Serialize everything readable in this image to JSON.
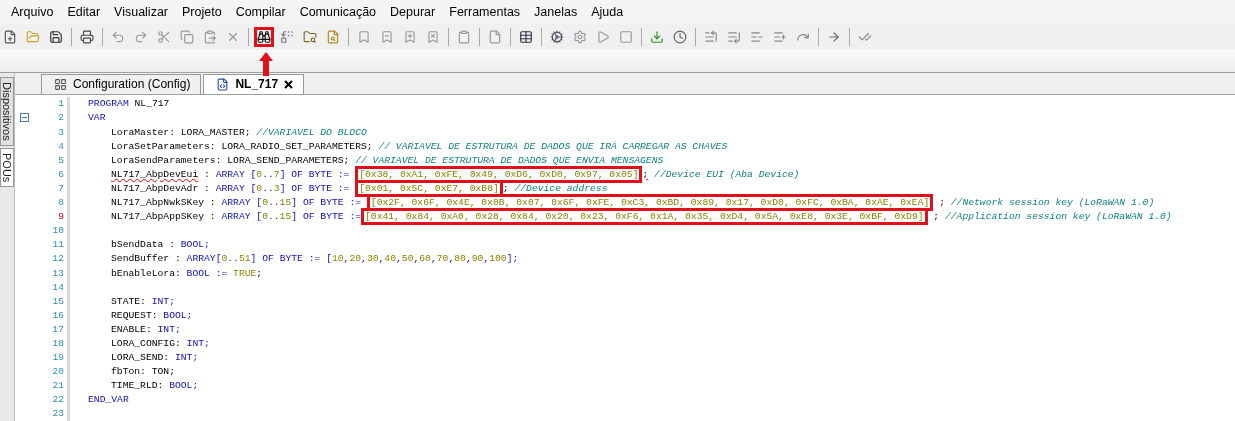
{
  "menu": [
    "Arquivo",
    "Editar",
    "Visualizar",
    "Projeto",
    "Compilar",
    "Comunicação",
    "Depurar",
    "Ferramentas",
    "Janelas",
    "Ajuda"
  ],
  "toolbar": [
    {
      "kind": "button",
      "highlighted": false
    },
    {
      "kind": "button",
      "highlighted": false
    },
    {
      "kind": "button",
      "highlighted": false
    },
    {
      "kind": "separator"
    },
    {
      "kind": "button",
      "highlighted": false
    },
    {
      "kind": "separator"
    },
    {
      "kind": "button",
      "highlighted": false
    },
    {
      "kind": "button",
      "highlighted": false
    },
    {
      "kind": "button",
      "highlighted": false
    },
    {
      "kind": "button",
      "highlighted": false
    },
    {
      "kind": "button",
      "highlighted": false
    },
    {
      "kind": "button",
      "highlighted": false
    },
    {
      "kind": "separator"
    },
    {
      "kind": "button",
      "highlighted": true
    },
    {
      "kind": "button",
      "highlighted": false
    },
    {
      "kind": "button",
      "highlighted": false
    },
    {
      "kind": "button",
      "highlighted": false
    },
    {
      "kind": "separator"
    },
    {
      "kind": "button",
      "highlighted": false
    },
    {
      "kind": "button",
      "highlighted": false
    },
    {
      "kind": "button",
      "highlighted": false
    },
    {
      "kind": "button",
      "highlighted": false
    },
    {
      "kind": "separator"
    },
    {
      "kind": "button",
      "highlighted": false
    },
    {
      "kind": "separator"
    },
    {
      "kind": "button",
      "highlighted": false
    },
    {
      "kind": "separator"
    },
    {
      "kind": "button",
      "highlighted": false
    },
    {
      "kind": "separator"
    },
    {
      "kind": "button",
      "highlighted": false
    },
    {
      "kind": "button",
      "highlighted": false
    },
    {
      "kind": "button",
      "highlighted": false
    },
    {
      "kind": "button",
      "highlighted": false
    },
    {
      "kind": "separator"
    },
    {
      "kind": "button",
      "highlighted": false
    },
    {
      "kind": "button",
      "highlighted": false
    },
    {
      "kind": "separator"
    },
    {
      "kind": "button",
      "highlighted": false
    },
    {
      "kind": "button",
      "highlighted": false
    },
    {
      "kind": "button",
      "highlighted": false
    },
    {
      "kind": "button",
      "highlighted": false
    },
    {
      "kind": "button",
      "highlighted": false
    },
    {
      "kind": "separator"
    },
    {
      "kind": "button",
      "highlighted": false
    },
    {
      "kind": "separator"
    },
    {
      "kind": "button",
      "highlighted": false
    }
  ],
  "side_tabs": [
    {
      "label": "Dispositivos",
      "selected": false
    },
    {
      "label": "POUs",
      "selected": true
    }
  ],
  "tabs": [
    {
      "label": "Configuration (Config)",
      "selected": false,
      "closable": false
    },
    {
      "label": "NL_717",
      "selected": true,
      "closable": true
    }
  ],
  "editor": {
    "lines": [
      {
        "number": "1",
        "indented": false,
        "tokens": [
          {
            "kind": "keyword",
            "text": "PROGRAM"
          },
          {
            "kind": "text",
            "text": "NL_717"
          }
        ]
      },
      {
        "number": "2",
        "indented": false,
        "foldable": true,
        "tokens": [
          {
            "kind": "keyword",
            "text": "VAR"
          }
        ]
      },
      {
        "number": "3",
        "indented": true,
        "tokens": [
          {
            "kind": "text",
            "text": "LoraMaster: LORA_MASTER;"
          },
          {
            "kind": "comment",
            "text": "//VARIAVEL DO BLOCO"
          }
        ]
      },
      {
        "number": "4",
        "indented": true,
        "tokens": [
          {
            "kind": "text",
            "text": "LoraSetParameters: LORA_RADIO_SET_PARAMETERS;"
          },
          {
            "kind": "comment",
            "text": "// VARIAVEL DE ESTRUTURA DE DADOS QUE IRÁ CARREGAR AS CHAVES"
          }
        ]
      },
      {
        "number": "5",
        "indented": true,
        "tokens": [
          {
            "kind": "text",
            "text": "LoraSendParameters: LORA_SEND_PARAMETERS;"
          },
          {
            "kind": "comment",
            "text": "// VARIAVEL DE ESTRUTURA DE DADOS QUE ENVIA MENSAGENS"
          }
        ]
      },
      {
        "number": "6",
        "indented": true,
        "tokens": [
          {
            "kind": "text",
            "text": "NL717_AbpDevEui",
            "error": true
          },
          {
            "kind": "text",
            "text": ":"
          },
          {
            "kind": "keyword",
            "text": "ARRAY [0..7] OF BYTE :="
          },
          {
            "kind": "literal",
            "text": "[0x38, 0xA1, 0xFE, 0x49, 0xD6, 0xD0, 0x97, 0x05]",
            "boxed": true
          },
          {
            "kind": "text",
            "text": ";",
            "joined": true,
            "error": true
          },
          {
            "kind": "comment",
            "text": "//Device EUI (Aba Device)"
          }
        ]
      },
      {
        "number": "7",
        "indented": true,
        "tokens": [
          {
            "kind": "text",
            "text": "NL717_AbpDevAdr"
          },
          {
            "kind": "text",
            "text": ":"
          },
          {
            "kind": "keyword",
            "text": "ARRAY [0..3] OF BYTE :="
          },
          {
            "kind": "literal",
            "text": "[0x01, 0x5C, 0xE7, 0xB8]",
            "boxed": true
          },
          {
            "kind": "text",
            "text": ";",
            "joined": true
          },
          {
            "kind": "comment",
            "text": "//Device address"
          }
        ]
      },
      {
        "number": "8",
        "indented": true,
        "tokens": [
          {
            "kind": "text",
            "text": "NL717_AbpNwkSKey"
          },
          {
            "kind": "text",
            "text": ":"
          },
          {
            "kind": "keyword",
            "text": "ARRAY [0..15] OF BYTE :="
          },
          {
            "kind": "literal",
            "text": "[0x2F, 0x6F, 0x4E, 0x0B, 0x07, 0x6F, 0xFE, 0xC3, 0xBD, 0x89, 0x17, 0xD0, 0xFC, 0xBA, 0xAE, 0xEA]",
            "boxed": true
          },
          {
            "kind": "text",
            "text": ";"
          },
          {
            "kind": "comment",
            "text": "//Network session key (LoRaWAN 1.0)"
          }
        ]
      },
      {
        "number": "9",
        "indented": true,
        "marked": true,
        "tokens": [
          {
            "kind": "text",
            "text": "NL717_AbpAppSKey"
          },
          {
            "kind": "text",
            "text": ":"
          },
          {
            "kind": "keyword",
            "text": "ARRAY [0..15] OF BYTE :="
          },
          {
            "kind": "literal",
            "text": "[0x41, 0x84, 0xA0, 0x28, 0x84, 0x20, 0x23, 0xF6, 0x1A, 0x35, 0xD4, 0x5A, 0xE8, 0x3E, 0xBF, 0xD9]",
            "boxed": true,
            "joined": true
          },
          {
            "kind": "text",
            "text": ";"
          },
          {
            "kind": "comment",
            "text": "//Application session key (LoRaWAN 1.0)"
          }
        ]
      },
      {
        "number": "10"
      },
      {
        "number": "11",
        "indented": true,
        "tokens": [
          {
            "kind": "text",
            "text": "bSendData :"
          },
          {
            "kind": "keyword",
            "text": "BOOL;"
          }
        ]
      },
      {
        "number": "12",
        "indented": true,
        "tokens": [
          {
            "kind": "text",
            "text": "SendBuffer :"
          },
          {
            "kind": "keyword",
            "text": "ARRAY[0..51] OF BYTE :="
          },
          {
            "kind": "keyword",
            "text": "[10,20,30,40,50,60,70,80,90,100];"
          }
        ]
      },
      {
        "number": "13",
        "indented": true,
        "tokens": [
          {
            "kind": "text",
            "text": "bEnableLora:"
          },
          {
            "kind": "keyword",
            "text": "BOOL :="
          },
          {
            "kind": "literal",
            "text": "TRUE"
          },
          {
            "kind": "text",
            "text": ";",
            "joined": true
          }
        ]
      },
      {
        "number": "14"
      },
      {
        "number": "15",
        "indented": true,
        "tokens": [
          {
            "kind": "text",
            "text": "STATE:"
          },
          {
            "kind": "keyword",
            "text": "INT;"
          }
        ]
      },
      {
        "number": "16",
        "indented": true,
        "tokens": [
          {
            "kind": "text",
            "text": "REQUEST:"
          },
          {
            "kind": "keyword",
            "text": "BOOL;"
          }
        ]
      },
      {
        "number": "17",
        "indented": true,
        "tokens": [
          {
            "kind": "text",
            "text": "ENABLE:"
          },
          {
            "kind": "keyword",
            "text": "INT;"
          }
        ]
      },
      {
        "number": "18",
        "indented": true,
        "tokens": [
          {
            "kind": "text",
            "text": "LORA_CONFIG:"
          },
          {
            "kind": "keyword",
            "text": "INT;"
          }
        ]
      },
      {
        "number": "19",
        "indented": true,
        "tokens": [
          {
            "kind": "text",
            "text": "LORA_SEND:"
          },
          {
            "kind": "keyword",
            "text": "INT;"
          }
        ]
      },
      {
        "number": "20",
        "indented": true,
        "tokens": [
          {
            "kind": "text",
            "text": "fbTon: TON;"
          }
        ]
      },
      {
        "number": "21",
        "indented": true,
        "tokens": [
          {
            "kind": "text",
            "text": "TIME_RLD:"
          },
          {
            "kind": "keyword",
            "text": "BOOL;"
          }
        ]
      },
      {
        "number": "22",
        "indented": false,
        "tokens": [
          {
            "kind": "keyword",
            "text": "END_VAR"
          }
        ]
      },
      {
        "number": "23"
      }
    ]
  }
}
